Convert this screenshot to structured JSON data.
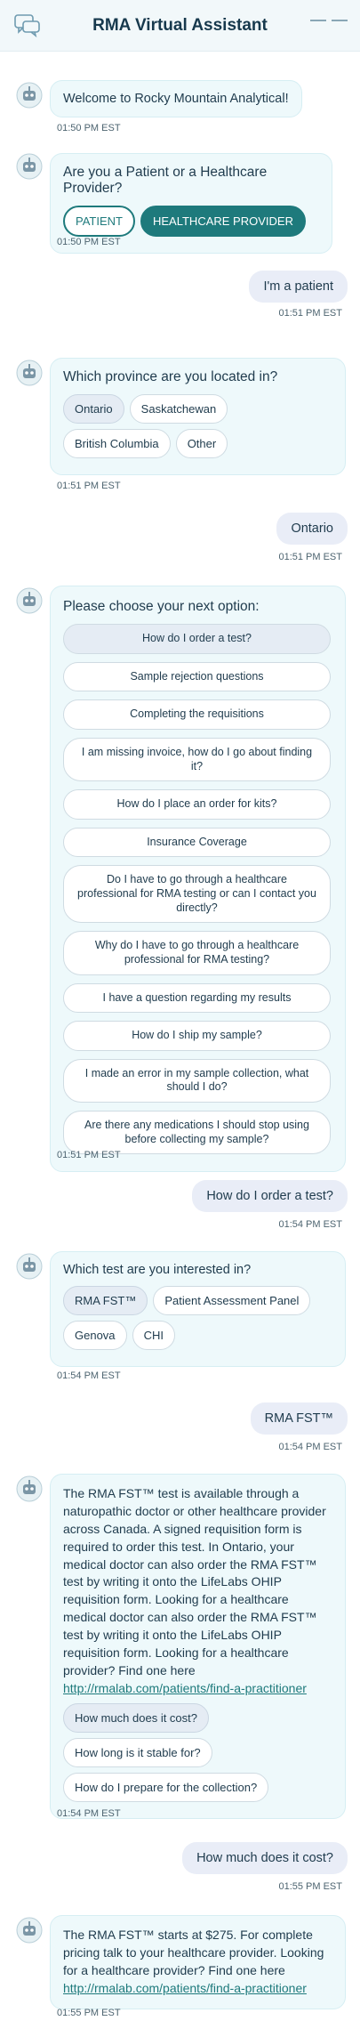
{
  "header": {
    "title": "RMA Virtual Assistant",
    "chat_icon": "chat-bubbles-icon",
    "minimize_icon": "minimize-icon"
  },
  "colors": {
    "accent": "#1e7a7c",
    "bot_bubble": "#eef9fb",
    "user_bubble": "#e9edf7"
  },
  "messages": {
    "m1": {
      "text": "Welcome to Rocky Mountain Analytical!",
      "time": "01:50 PM EST"
    },
    "m2": {
      "question": "Are you a Patient or a Healthcare Provider?",
      "options": [
        "PATIENT",
        "HEALTHCARE PROVIDER"
      ],
      "time": "01:50 PM EST"
    },
    "u1": {
      "text": "I'm a patient",
      "time": "01:51 PM EST"
    },
    "m3": {
      "question": "Which province are you located in?",
      "options": [
        "Ontario",
        "Saskatchewan",
        "British Columbia",
        "Other"
      ],
      "time": "01:51 PM EST"
    },
    "u2": {
      "text": "Ontario",
      "time": "01:51 PM EST"
    },
    "m4": {
      "question": "Please choose your next option:",
      "options": [
        "How do I order a test?",
        "Sample rejection questions",
        "Completing the requisitions",
        "I am missing invoice, how do I go about finding it?",
        "How do I place an order for kits?",
        "Insurance Coverage",
        "Do I have to go through a healthcare professional for RMA testing or can I contact you directly?",
        "Why do I have to go through a healthcare professional for RMA testing?",
        "I have a question regarding my results",
        "How do I ship my sample?",
        "I made an error in my sample collection, what should I do?",
        "Are there any medications I should stop using before collecting my sample?"
      ],
      "time": "01:51 PM EST"
    },
    "u3": {
      "text": "How do I order a test?",
      "time": "01:54 PM EST"
    },
    "m5": {
      "question": "Which test are you interested in?",
      "options": [
        "RMA FST™",
        "Patient Assessment Panel",
        "Genova",
        "CHI"
      ],
      "time": "01:54 PM EST"
    },
    "u4": {
      "text": "RMA FST™",
      "time": "01:54 PM EST"
    },
    "m6": {
      "text": "The RMA FST™ test is available through a naturopathic doctor or other healthcare provider across Canada. A signed requisition form is required to order this test. In Ontario, your medical doctor can also order the RMA FST™ test by writing it onto the LifeLabs OHIP requisition form. Looking for a healthcare medical doctor can also order the RMA FST™ test by writing it onto the LifeLabs OHIP requisition form. Looking for a healthcare provider? Find one here",
      "link": "http://rmalab.com/patients/find-a-practitioner",
      "options": [
        "How much does it cost?",
        "How long is it stable for?",
        "How do I prepare for the collection?"
      ],
      "time": "01:54 PM EST"
    },
    "u5": {
      "text": "How much does it cost?",
      "time": "01:55 PM EST"
    },
    "m7": {
      "text": "The RMA FST™ starts at $275. For complete pricing talk to your healthcare provider. Looking for a healthcare provider? Find one here",
      "link": "http://rmalab.com/patients/find-a-practitioner",
      "time": "01:55 PM EST"
    }
  }
}
